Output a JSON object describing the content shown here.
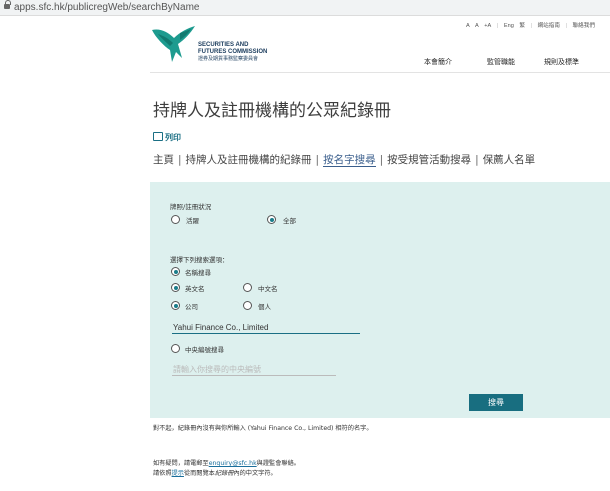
{
  "browser": {
    "url": "apps.sfc.hk/publicregWeb/searchByName"
  },
  "header": {
    "top_links": [
      "A",
      "A",
      "+A",
      "Eng",
      "繁",
      "網站指南",
      "聯絡我們"
    ],
    "logo_en_line1": "SECURITIES AND",
    "logo_en_line2": "FUTURES COMMISSION",
    "logo_cn": "證券及期貨事務監察委員會",
    "nav": [
      "本會簡介",
      "監管職能",
      "規則及標準"
    ]
  },
  "page": {
    "title": "持牌人及註冊機構的公眾紀錄冊",
    "print_label": "列印"
  },
  "subnav": {
    "home": "主頁",
    "register": "持牌人及註冊機構的紀錄冊",
    "by_name": "按名字搜尋",
    "by_activity": "按受規管活動搜尋",
    "sponsors": "保薦人名單"
  },
  "form": {
    "status_label": "牌照/註冊狀況",
    "status_options": [
      "活躍",
      "全部"
    ],
    "status_selected": "全部",
    "criteria_label": "選擇下列搜索選項：",
    "name_search_label": "名稱搜尋",
    "lang_options": [
      "英文名",
      "中文名"
    ],
    "lang_selected": "英文名",
    "type_options": [
      "公司",
      "個人"
    ],
    "type_selected": "公司",
    "name_value": "Yahui Finance Co., Limited",
    "ce_search_label": "中央編號搜尋",
    "ce_placeholder": "請輸入你搜尋的中央編號",
    "search_button": "搜尋"
  },
  "result": {
    "message": "對不起，紀錄冊內沒有與你所輸入 (Yahui Finance Co., Limited) 相符的名字。"
  },
  "contact": {
    "line1_prefix": "如有疑問，請電郵至",
    "email": "enquiry@sfc.hk",
    "line1_suffix": "與證監會聯絡。",
    "line2_prefix": "請依照",
    "hint_link": "提示",
    "line2_mid": "從而閱覽本",
    "line2_register": "紀錄冊",
    "line2_suffix": "內的中文字符。"
  },
  "colors": {
    "panel_bg": "#ddf0ee",
    "accent": "#186e80"
  }
}
